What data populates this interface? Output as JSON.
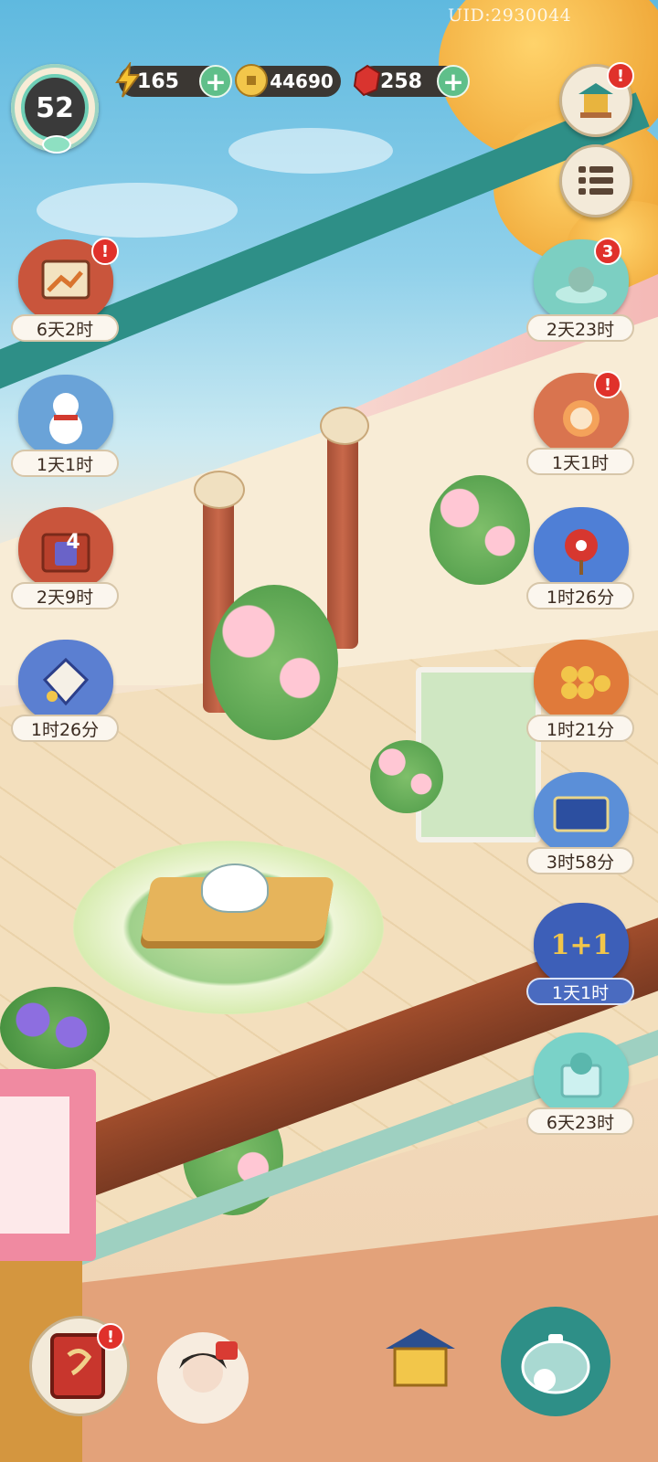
{
  "uid": "UID:2930044",
  "player": {
    "level": "52"
  },
  "resources": [
    {
      "name": "energy",
      "icon": "lightning-icon",
      "value": "165",
      "has_plus": true
    },
    {
      "name": "coins",
      "icon": "coin-icon",
      "value": "44690",
      "has_plus": false
    },
    {
      "name": "gems",
      "icon": "red-gem-icon",
      "value": "258",
      "has_plus": true
    }
  ],
  "top_right": {
    "shop_alert": "!",
    "menu_icon": "list-icon"
  },
  "events_left": [
    {
      "icon": "autumn-scroll-icon",
      "time": "6天2时",
      "alert": "!",
      "color": "#c9553c"
    },
    {
      "icon": "snow-cat-icon",
      "time": "1天1时",
      "alert": "",
      "color": "#6aa3d8"
    },
    {
      "icon": "gift-box-icon",
      "time": "2天9时",
      "alert": "",
      "color": "#c9553c",
      "label": "4"
    },
    {
      "icon": "kite-icon",
      "time": "1时26分",
      "alert": "",
      "color": "#5b7fd1"
    }
  ],
  "events_right": [
    {
      "icon": "hotspring-cat-icon",
      "time": "2天23时",
      "alert": "3",
      "color": "#7ccfc2"
    },
    {
      "icon": "lucky-cat-icon",
      "time": "1天1时",
      "alert": "!",
      "color": "#d9744f"
    },
    {
      "icon": "fan-icon",
      "time": "1时26分",
      "alert": "",
      "color": "#4f7fd6"
    },
    {
      "icon": "coins-scroll-icon",
      "time": "1时21分",
      "alert": "",
      "color": "#e07a3a"
    },
    {
      "icon": "map-icon",
      "time": "3时58分",
      "alert": "",
      "color": "#5b8fd8"
    },
    {
      "icon": "bonus-icon",
      "time": "1天1时",
      "alert": "",
      "color": "#3d5fb8",
      "label": "1+1"
    },
    {
      "icon": "ice-cat-icon",
      "time": "6天23时",
      "alert": "",
      "color": "#7ad2c8"
    }
  ],
  "bottom": {
    "book_alert": "!",
    "book_icon": "red-book-icon",
    "character_icon": "character-portrait-icon",
    "house_icon": "pavilion-icon",
    "teapot_icon": "teapot-icon"
  }
}
